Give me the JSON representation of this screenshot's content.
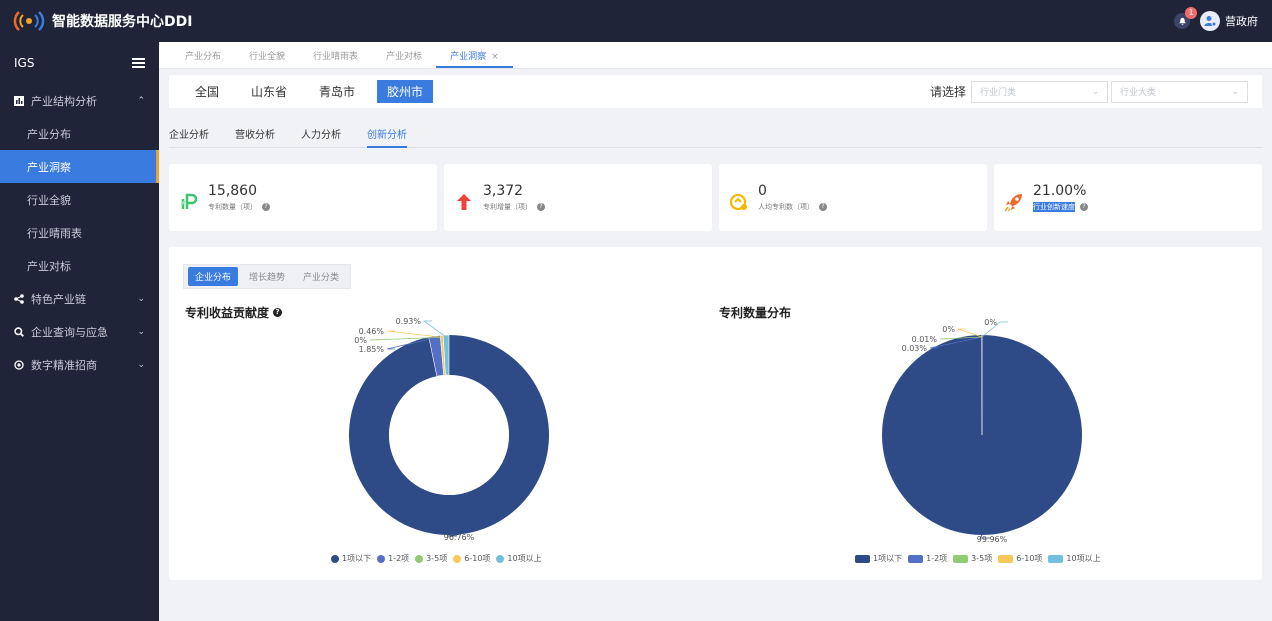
{
  "header": {
    "app_title": "智能数据服务中心DDI",
    "notification_count": "1",
    "user_name": "营政府"
  },
  "sidebar": {
    "title": "IGS",
    "groups": [
      {
        "label": "产业结构分析",
        "icon": "bar-chart-icon",
        "expanded": true
      },
      {
        "label": "特色产业链",
        "icon": "share-icon"
      },
      {
        "label": "企业查询与应急",
        "icon": "search-icon"
      },
      {
        "label": "数字精准招商",
        "icon": "target-icon"
      }
    ],
    "sub_items": [
      {
        "label": "产业分布"
      },
      {
        "label": "产业洞察",
        "active": true
      },
      {
        "label": "行业全貌"
      },
      {
        "label": "行业晴雨表"
      },
      {
        "label": "产业对标"
      }
    ]
  },
  "page_tabs": [
    {
      "label": "产业分布"
    },
    {
      "label": "行业全貌"
    },
    {
      "label": "行业晴雨表"
    },
    {
      "label": "产业对标"
    },
    {
      "label": "产业洞察",
      "active": true
    }
  ],
  "regions": {
    "items": [
      "全国",
      "山东省",
      "青岛市",
      "胶州市"
    ],
    "selected": "胶州市",
    "select_label": "请选择",
    "select1_placeholder": "行业门类",
    "select2_placeholder": "行业大类"
  },
  "analysis_tabs": [
    "企业分析",
    "营收分析",
    "人力分析",
    "创新分析"
  ],
  "analysis_tab_active": "创新分析",
  "stats": [
    {
      "value": "15,860",
      "label": "专利数量（项）",
      "icon": "patent-icon",
      "color": "#3ec46d"
    },
    {
      "value": "3,372",
      "label": "专利增量（项）",
      "icon": "arrow-up-icon",
      "color": "#f0413c"
    },
    {
      "value": "0",
      "label": "人均专利数（项）",
      "icon": "coin-icon",
      "color": "#f5b800"
    },
    {
      "value": "21.00%",
      "label": "行业创新速度",
      "icon": "rocket-icon",
      "color": "#f06b2a"
    }
  ],
  "segment": {
    "items": [
      "企业分布",
      "增长趋势",
      "产业分类"
    ],
    "active": "企业分布"
  },
  "colors": [
    "#2e4a87",
    "#5470c6",
    "#91cc75",
    "#fac858",
    "#73c0de"
  ],
  "chart_data": [
    {
      "type": "pie",
      "title": "专利收益贡献度",
      "categories": [
        "1项以下",
        "1-2项",
        "3-5项",
        "6-10项",
        "10项以上"
      ],
      "values": [
        96.76,
        1.85,
        0,
        0.46,
        0.93
      ],
      "labels": [
        "96.76%",
        "1.85%",
        "0%",
        "0.46%",
        "0.93%"
      ],
      "donut": true,
      "legend_position": "bottom"
    },
    {
      "type": "pie",
      "title": "专利数量分布",
      "categories": [
        "1项以下",
        "1-2项",
        "3-5项",
        "6-10项",
        "10项以上"
      ],
      "values": [
        99.96,
        0.03,
        0.01,
        0,
        0
      ],
      "labels": [
        "99.96%",
        "0.03%",
        "0.01%",
        "0%",
        "0%"
      ],
      "donut": false,
      "legend_position": "bottom"
    }
  ]
}
